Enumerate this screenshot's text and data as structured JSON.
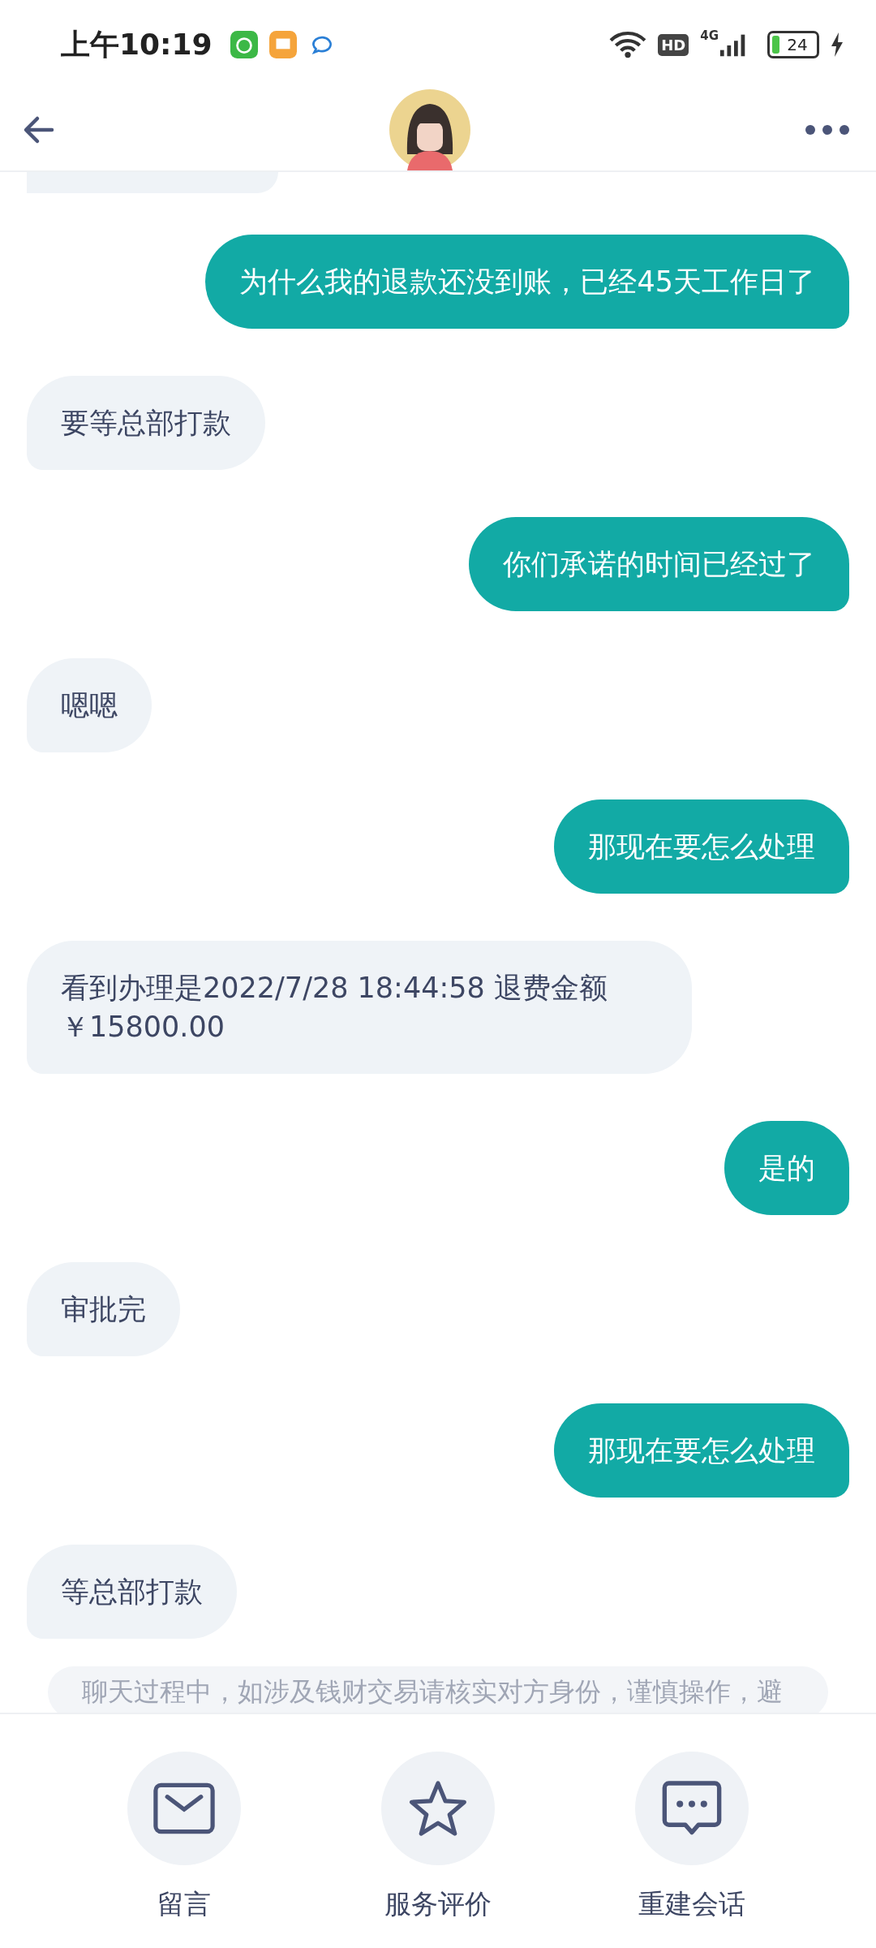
{
  "status_bar": {
    "time": "上午10:19",
    "hd": "HD",
    "network": "4G",
    "battery": "24"
  },
  "messages": [
    {
      "kind": "sent",
      "text": "为什么我的退款还没到账，已经45天工作日了"
    },
    {
      "kind": "received",
      "text": "要等总部打款"
    },
    {
      "kind": "sent",
      "text": "你们承诺的时间已经过了"
    },
    {
      "kind": "received",
      "text": "嗯嗯"
    },
    {
      "kind": "sent",
      "text": "那现在要怎么处理"
    },
    {
      "kind": "received",
      "text": "看到办理是2022/7/28 18:44:58 退费金额￥15800.00"
    },
    {
      "kind": "sent",
      "text": "是的"
    },
    {
      "kind": "received",
      "text": "审批完"
    },
    {
      "kind": "sent",
      "text": "那现在要怎么处理"
    },
    {
      "kind": "received",
      "text": "等总部打款"
    }
  ],
  "notice": "聊天过程中，如涉及钱财交易请核实对方身份，谨慎操作，避",
  "actions": [
    {
      "kind": "message",
      "label": "留言"
    },
    {
      "kind": "rate",
      "label": "服务评价"
    },
    {
      "kind": "chat",
      "label": "重建会话"
    }
  ]
}
